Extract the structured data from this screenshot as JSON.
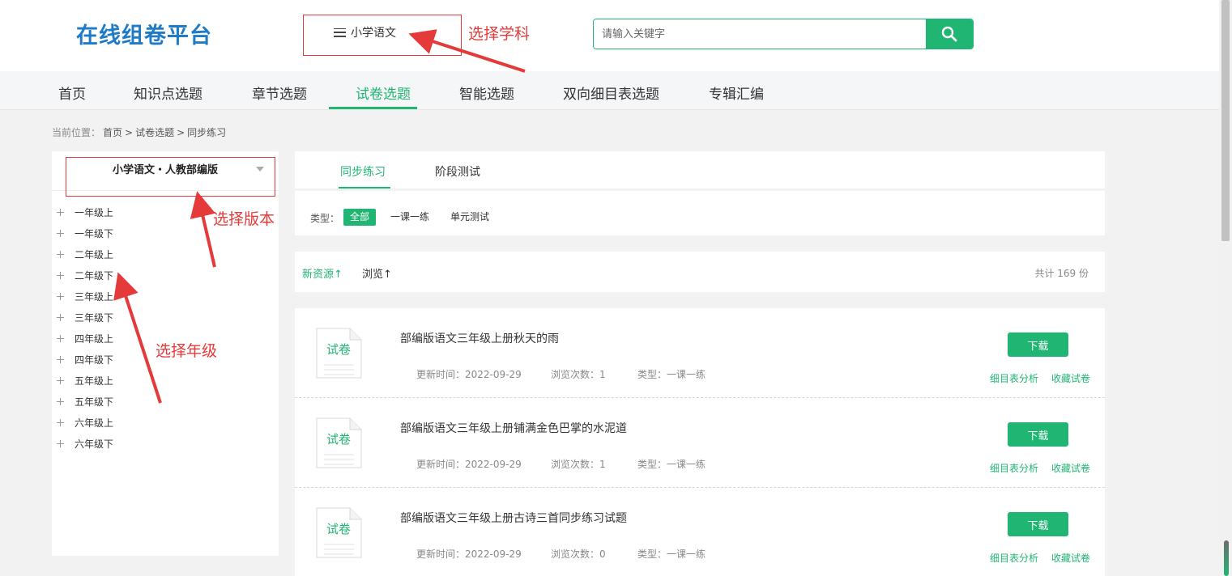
{
  "header": {
    "logo": "在线组卷平台",
    "subject_button": "小学语文",
    "search_placeholder": "请输入关键字"
  },
  "nav": {
    "items": [
      "首页",
      "知识点选题",
      "章节选题",
      "试卷选题",
      "智能选题",
      "双向细目表选题",
      "专辑汇编"
    ],
    "active": "试卷选题"
  },
  "breadcrumb": {
    "prefix": "当前位置：",
    "items": [
      "首页",
      ">",
      "试卷选题",
      ">",
      "同步练习"
    ]
  },
  "sidebar": {
    "edition": "小学语文・人教部编版",
    "grades": [
      "一年级上",
      "一年级下",
      "二年级上",
      "二年级下",
      "三年级上",
      "三年级下",
      "四年级上",
      "四年级下",
      "五年级上",
      "五年级下",
      "六年级上",
      "六年级下"
    ]
  },
  "tabs": [
    "同步练习",
    "阶段测试"
  ],
  "filter": {
    "label": "类型：",
    "options": [
      "全部",
      "一课一练",
      "单元测试"
    ]
  },
  "sort": {
    "options": [
      "新资源↑",
      "浏览↑"
    ],
    "total": "共计 169 份"
  },
  "papers": [
    {
      "icon_text": "试卷",
      "title": "部编版语文三年级上册秋天的雨",
      "updated": "更新时间：2022-09-29",
      "views": "浏览次数：1",
      "type": "类型：一课一练",
      "download": "下载",
      "analysis": "细目表分析",
      "favorite": "收藏试卷"
    },
    {
      "icon_text": "试卷",
      "title": "部编版语文三年级上册铺满金色巴掌的水泥道",
      "updated": "更新时间：2022-09-29",
      "views": "浏览次数：1",
      "type": "类型：一课一练",
      "download": "下载",
      "analysis": "细目表分析",
      "favorite": "收藏试卷"
    },
    {
      "icon_text": "试卷",
      "title": "部编版语文三年级上册古诗三首同步练习试题",
      "updated": "更新时间：2022-09-29",
      "views": "浏览次数：0",
      "type": "类型：一课一练",
      "download": "下载",
      "analysis": "细目表分析",
      "favorite": "收藏试卷"
    }
  ],
  "annotations": {
    "subject": "选择学科",
    "edition": "选择版本",
    "grade": "选择年级"
  },
  "colors": {
    "accent": "#21b573",
    "logo": "#1f7bc8",
    "annotation": "#e53a3a"
  }
}
